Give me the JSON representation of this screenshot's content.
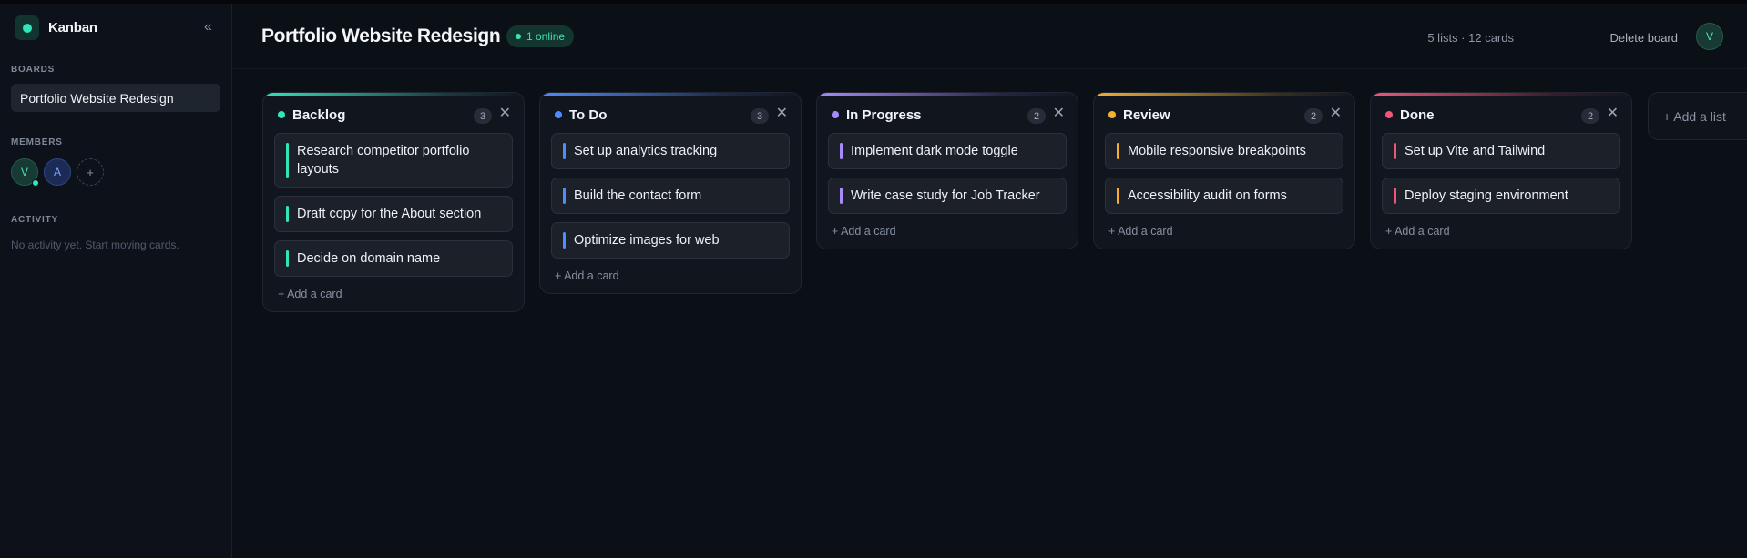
{
  "sidebar": {
    "brand": "Kanban",
    "collapse_icon": "«",
    "boards_label": "BOARDS",
    "boards": [
      "Portfolio Website Redesign"
    ],
    "members_label": "MEMBERS",
    "members": [
      "V",
      "A"
    ],
    "add_member_icon": "+",
    "activity_label": "ACTIVITY",
    "activity_empty": "No activity yet. Start moving cards."
  },
  "header": {
    "title": "Portfolio Website Redesign",
    "online_badge": "1 online",
    "stats": "5 lists · 12 cards",
    "delete_board": "Delete board",
    "avatar": "V"
  },
  "lists": [
    {
      "title": "Backlog",
      "count": "3",
      "color": "#2ee6b8",
      "cards": [
        "Research competitor portfolio layouts",
        "Draft copy for the About section",
        "Decide on domain name"
      ],
      "add_card": "+ Add a card"
    },
    {
      "title": "To Do",
      "count": "3",
      "color": "#4f8cff",
      "cards": [
        "Set up analytics tracking",
        "Build the contact form",
        "Optimize images for web"
      ],
      "add_card": "+ Add a card"
    },
    {
      "title": "In Progress",
      "count": "2",
      "color": "#a78bfa",
      "cards": [
        "Implement dark mode toggle",
        "Write case study for Job Tracker"
      ],
      "add_card": "+ Add a card"
    },
    {
      "title": "Review",
      "count": "2",
      "color": "#f5b031",
      "cards": [
        "Mobile responsive breakpoints",
        "Accessibility audit on forms"
      ],
      "add_card": "+ Add a card"
    },
    {
      "title": "Done",
      "count": "2",
      "color": "#f0567a",
      "cards": [
        "Set up Vite and Tailwind",
        "Deploy staging environment"
      ],
      "add_card": "+ Add a card"
    }
  ],
  "close_icon": "✕",
  "add_list": "+ Add a list"
}
